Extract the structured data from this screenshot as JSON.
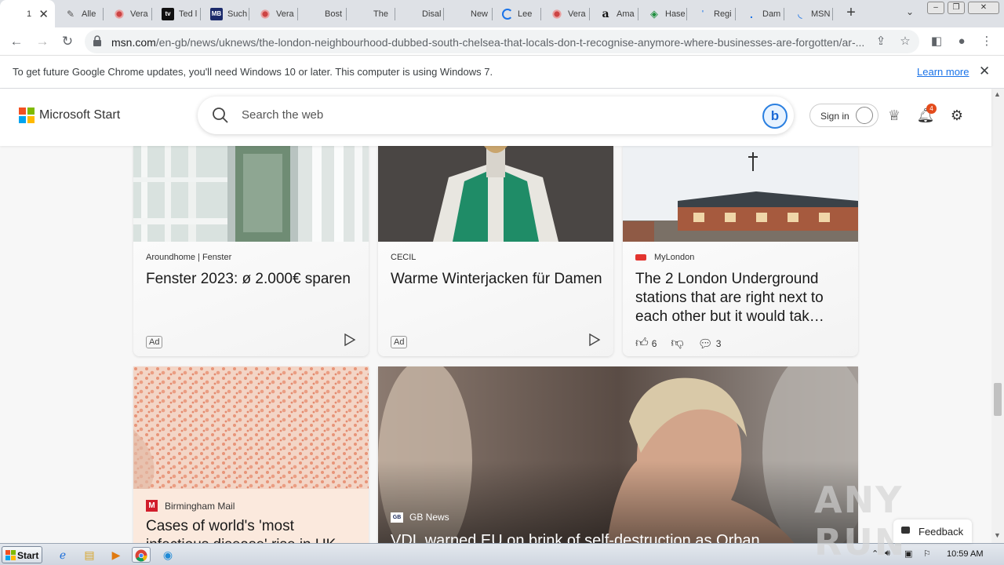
{
  "browser": {
    "tabs": [
      {
        "title": "1",
        "icon": "msn-icon",
        "active": true
      },
      {
        "title": "Alle",
        "icon": "pen-icon"
      },
      {
        "title": "Vera",
        "icon": "vera-icon"
      },
      {
        "title": "Ted l",
        "icon": "tv-icon"
      },
      {
        "title": "Such",
        "icon": "mb-icon"
      },
      {
        "title": "Vera",
        "icon": "vera-icon"
      },
      {
        "title": "Bost",
        "icon": "msn-icon"
      },
      {
        "title": "The",
        "icon": "msn-icon"
      },
      {
        "title": "Disal",
        "icon": "msn-icon"
      },
      {
        "title": "New",
        "icon": "msn-icon"
      },
      {
        "title": "Lee",
        "icon": "loading-icon"
      },
      {
        "title": "Vera",
        "icon": "vera-icon"
      },
      {
        "title": "Ama",
        "icon": "amazon-icon"
      },
      {
        "title": "Hase",
        "icon": "tag-icon"
      },
      {
        "title": "Regi",
        "icon": "dot-icon"
      },
      {
        "title": "Dam",
        "icon": "dot-icon"
      },
      {
        "title": "MSN",
        "icon": "dot-icon"
      }
    ],
    "new_tab": "+",
    "url_host": "msn.com",
    "url_path": "/en-gb/news/uknews/the-london-neighbourhood-dubbed-south-chelsea-that-locals-don-t-recognise-anymore-where-businesses-are-forgotten/ar-..."
  },
  "infobar": {
    "message": "To get future Google Chrome updates, you'll need Windows 10 or later. This computer is using Windows 7.",
    "link": "Learn more"
  },
  "msn": {
    "logo_text": "Microsoft Start",
    "search_placeholder": "Search the web",
    "bing_label": "b",
    "signin_label": "Sign in",
    "notification_count": "4"
  },
  "cards": [
    {
      "source": "Aroundhome | Fenster",
      "title": "Fenster 2023: ø 2.000€ sparen",
      "ad": "Ad"
    },
    {
      "source": "CECIL",
      "title": "Warme Winterjacken für Damen",
      "ad": "Ad"
    },
    {
      "source": "MyLondon",
      "title": "The 2 London Underground stations that are right next to each other but it would tak…",
      "likes": "6",
      "comments": "3"
    },
    {
      "source": "Birmingham Mail",
      "title": "Cases of world's 'most infectious disease' rise in UK"
    },
    {
      "source": "GB News",
      "title": "VDL warned EU on brink of self-destruction as Orban"
    }
  ],
  "feedback_label": "Feedback",
  "watermark": "ANY RUN",
  "taskbar": {
    "start_label": "Start",
    "time": "10:59 AM"
  },
  "colors": {
    "ms_red": "#f25022",
    "ms_green": "#7fba00",
    "ms_blue": "#00a4ef",
    "ms_yellow": "#ffb900",
    "link_blue": "#1a73e8",
    "badge": "#e34b1c"
  }
}
